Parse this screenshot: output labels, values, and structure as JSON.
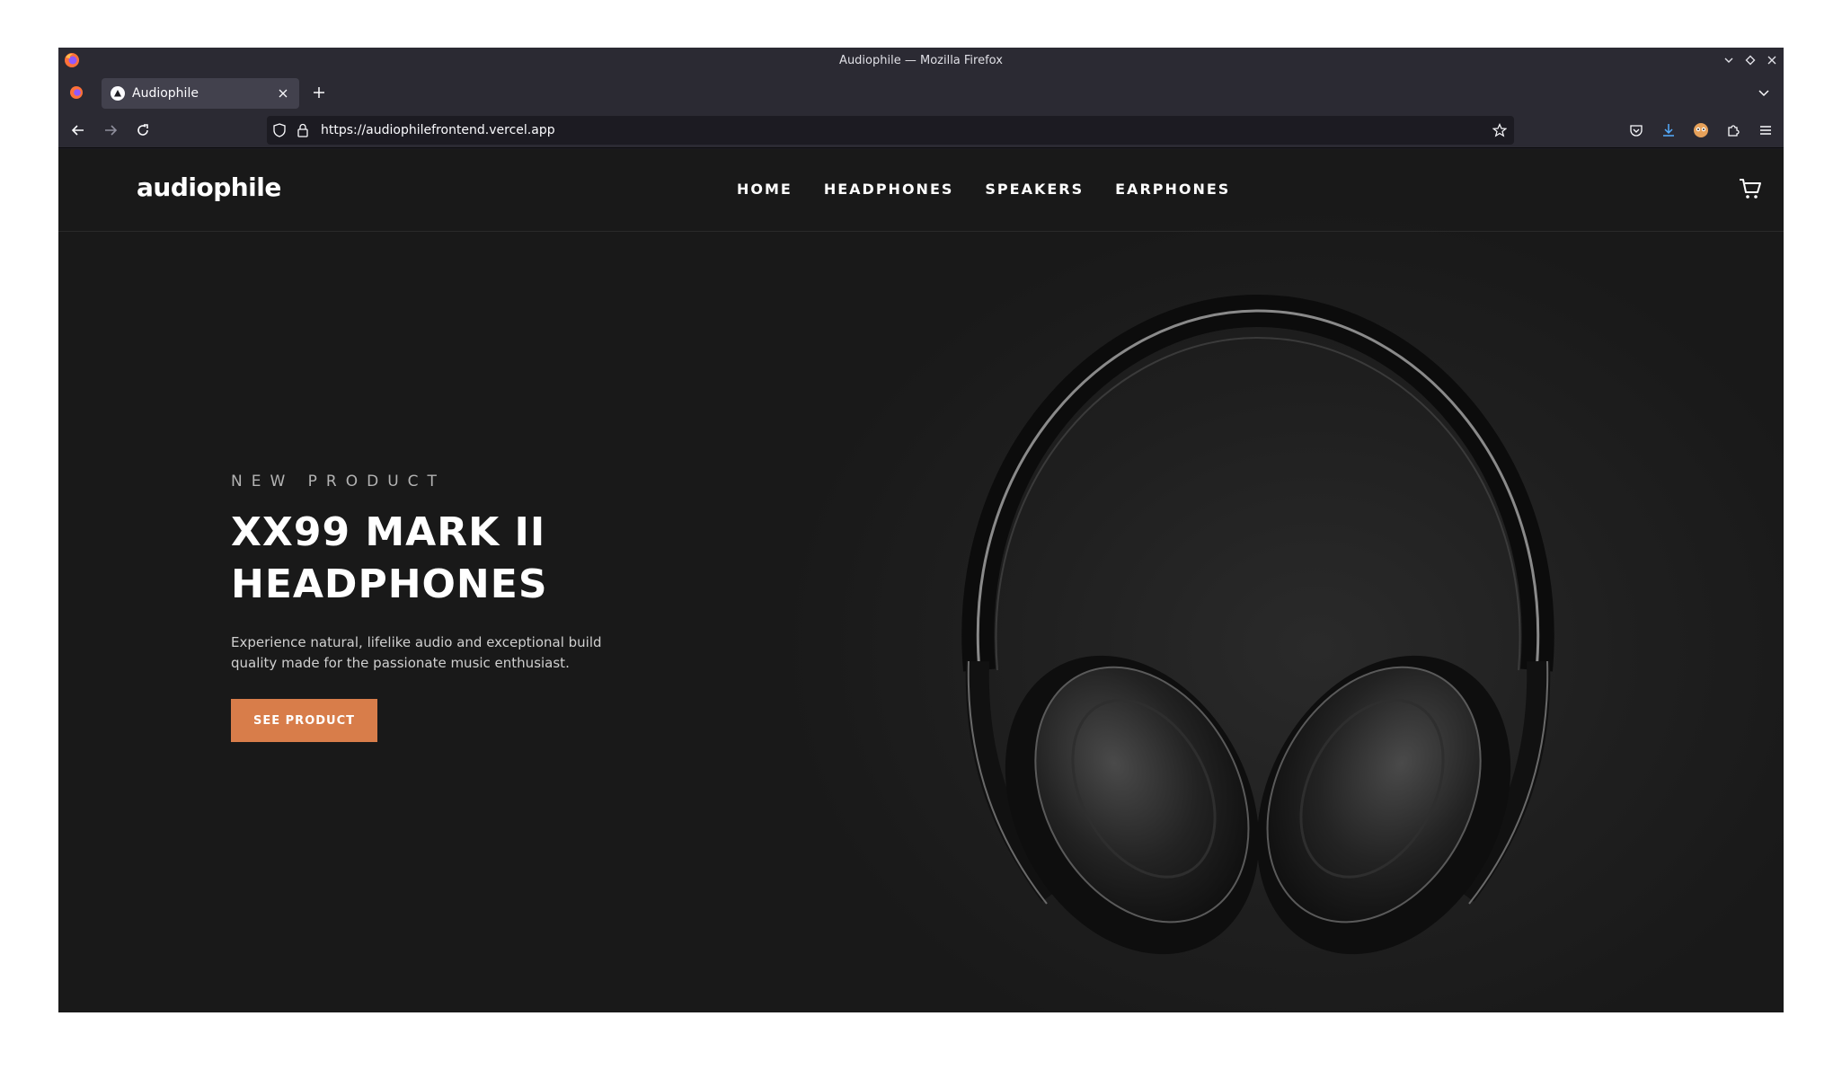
{
  "browser": {
    "window_title": "Audiophile — Mozilla Firefox",
    "tab_title": "Audiophile",
    "url": "https://audiophilefrontend.vercel.app"
  },
  "site": {
    "logo": "audiophile",
    "nav": [
      "HOME",
      "HEADPHONES",
      "SPEAKERS",
      "EARPHONES"
    ]
  },
  "hero": {
    "overline": "NEW PRODUCT",
    "title_line1": "XX99 MARK II",
    "title_line2": "HEADPHONES",
    "description": "Experience natural, lifelike audio and exceptional build quality made for the passionate music enthusiast.",
    "cta": "SEE PRODUCT"
  },
  "colors": {
    "accent": "#d87d4a",
    "page_bg": "#191919",
    "chrome_bg": "#2b2a33"
  },
  "icons": [
    "firefox-icon",
    "close-icon",
    "plus-icon",
    "chevron-down-icon",
    "back-icon",
    "forward-icon",
    "reload-icon",
    "shield-icon",
    "lock-icon",
    "star-icon",
    "pocket-icon",
    "download-icon",
    "account-icon",
    "extensions-icon",
    "menu-icon",
    "cart-icon"
  ]
}
